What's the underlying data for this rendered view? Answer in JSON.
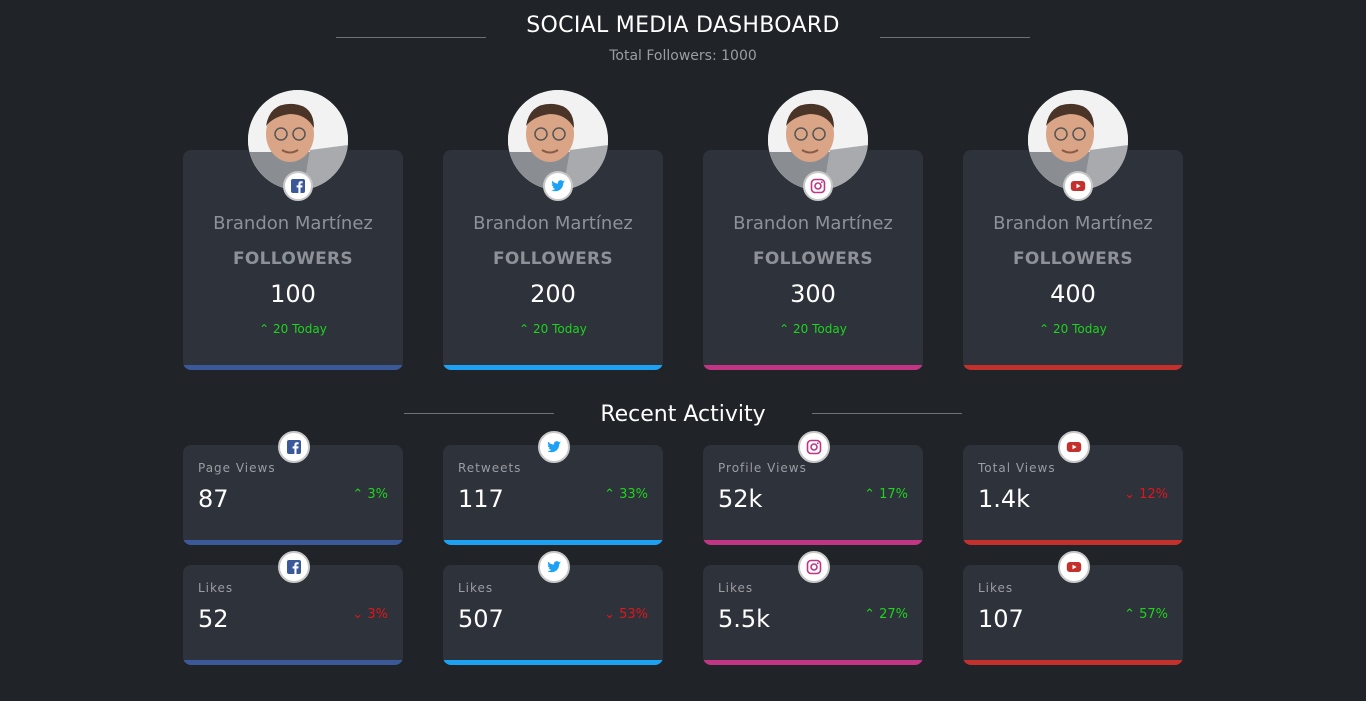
{
  "header": {
    "title": "SOCIAL MEDIA DASHBOARD",
    "subtitle": "Total Followers: 1000"
  },
  "colors": {
    "facebook": "#3b5998",
    "twitter": "#1da1f2",
    "instagram": "#c13584",
    "youtube": "#c4302b",
    "up": "#1ed41e",
    "down": "#e3141b"
  },
  "profiles": [
    {
      "network": "facebook",
      "icon": "facebook-icon",
      "name": "Brandon Martínez",
      "label": "FOLLOWERS",
      "count": "100",
      "today": "⌃ 20 Today"
    },
    {
      "network": "twitter",
      "icon": "twitter-icon",
      "name": "Brandon Martínez",
      "label": "FOLLOWERS",
      "count": "200",
      "today": "⌃ 20 Today"
    },
    {
      "network": "instagram",
      "icon": "instagram-icon",
      "name": "Brandon Martínez",
      "label": "FOLLOWERS",
      "count": "300",
      "today": "⌃ 20 Today"
    },
    {
      "network": "youtube",
      "icon": "youtube-icon",
      "name": "Brandon Martínez",
      "label": "FOLLOWERS",
      "count": "400",
      "today": "⌃ 20 Today"
    }
  ],
  "activity": {
    "title": "Recent Activity",
    "row1": [
      {
        "network": "facebook",
        "label": "Page Views",
        "value": "87",
        "change": "⌃ 3%",
        "trend": "up"
      },
      {
        "network": "twitter",
        "label": "Retweets",
        "value": "117",
        "change": "⌃ 33%",
        "trend": "up"
      },
      {
        "network": "instagram",
        "label": "Profile Views",
        "value": "52k",
        "change": "⌃ 17%",
        "trend": "up"
      },
      {
        "network": "youtube",
        "label": "Total Views",
        "value": "1.4k",
        "change": "⌄ 12%",
        "trend": "down"
      }
    ],
    "row2": [
      {
        "network": "facebook",
        "label": "Likes",
        "value": "52",
        "change": "⌄ 3%",
        "trend": "down"
      },
      {
        "network": "twitter",
        "label": "Likes",
        "value": "507",
        "change": "⌄ 53%",
        "trend": "down"
      },
      {
        "network": "instagram",
        "label": "Likes",
        "value": "5.5k",
        "change": "⌃ 27%",
        "trend": "up"
      },
      {
        "network": "youtube",
        "label": "Likes",
        "value": "107",
        "change": "⌃ 57%",
        "trend": "up"
      }
    ]
  }
}
